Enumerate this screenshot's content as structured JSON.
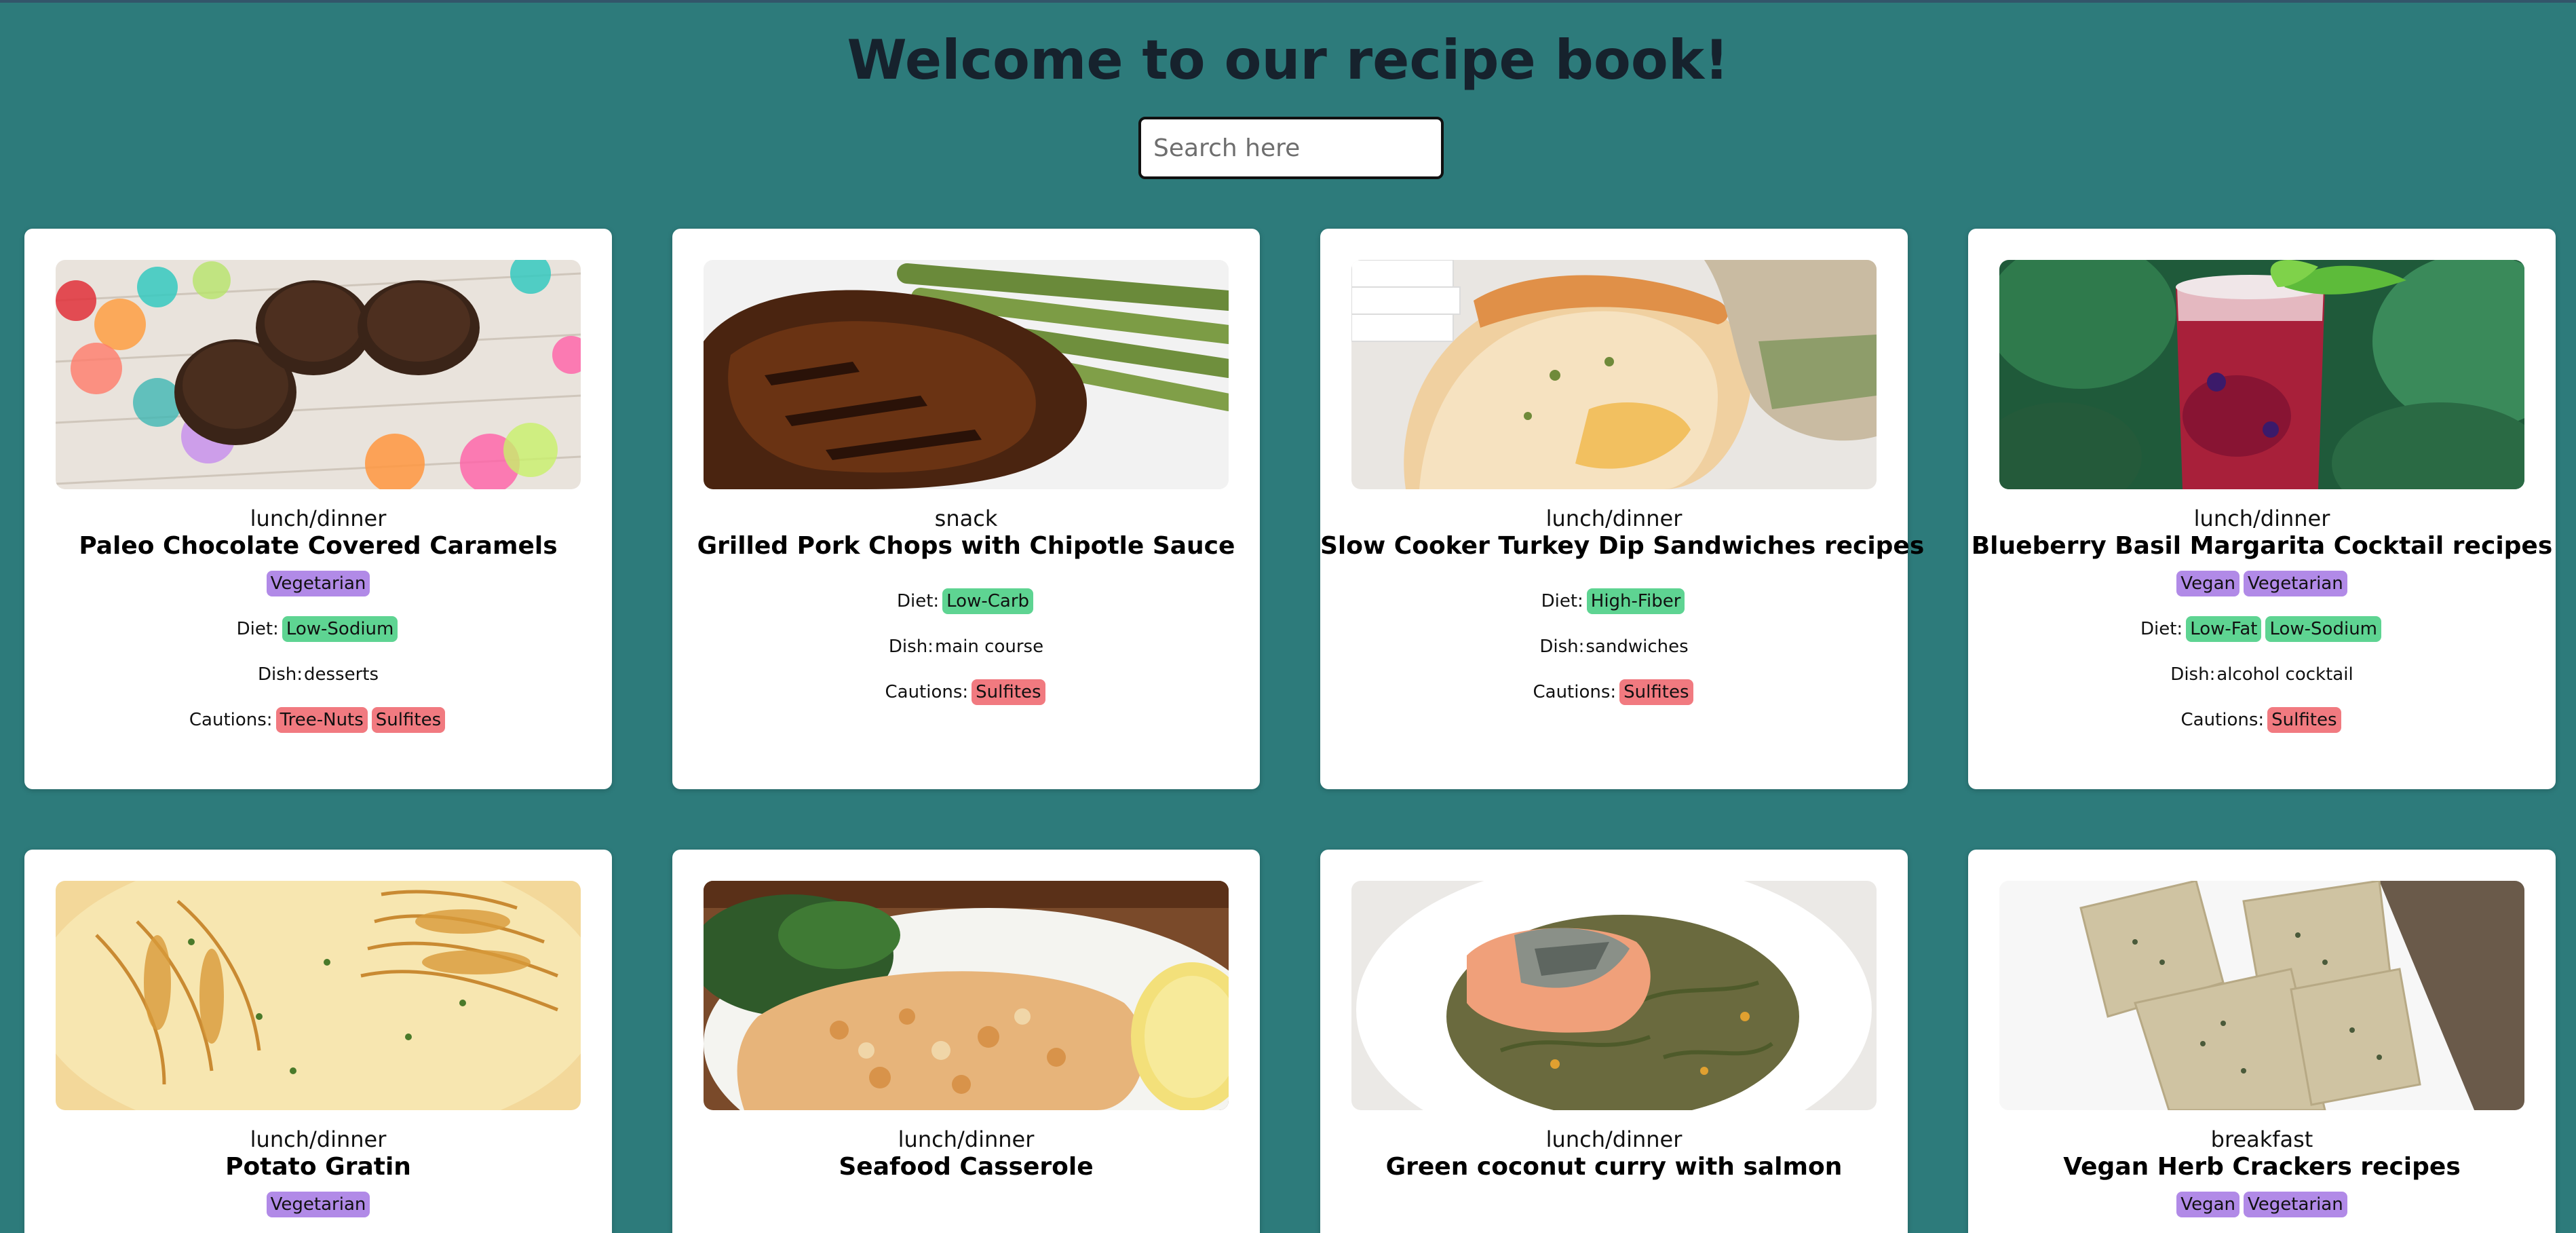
{
  "header": {
    "title": "Welcome to our recipe book!"
  },
  "search": {
    "placeholder": "Search here",
    "value": ""
  },
  "labels": {
    "diet": "Diet:",
    "dish": "Dish:",
    "cautions": "Cautions:"
  },
  "colors": {
    "background": "#2d7b7b",
    "health_tag": "#b18ae7",
    "diet_tag": "#5ed492",
    "caution_tag": "#f17a80"
  },
  "recipes": [
    {
      "meal": "lunch/dinner",
      "title": "Paleo Chocolate Covered Caramels",
      "health": [
        "Vegetarian"
      ],
      "diet": [
        "Low-Sodium"
      ],
      "dish": "desserts",
      "cautions": [
        "Tree-Nuts",
        "Sulfites"
      ]
    },
    {
      "meal": "snack",
      "title": "Grilled Pork Chops with Chipotle Sauce",
      "health": [],
      "diet": [
        "Low-Carb"
      ],
      "dish": "main course",
      "cautions": [
        "Sulfites"
      ]
    },
    {
      "meal": "lunch/dinner",
      "title": "Slow Cooker Turkey Dip Sandwiches recipes",
      "health": [],
      "diet": [
        "High-Fiber"
      ],
      "dish": "sandwiches",
      "cautions": [
        "Sulfites"
      ]
    },
    {
      "meal": "lunch/dinner",
      "title": "Blueberry Basil Margarita Cocktail recipes",
      "health": [
        "Vegan",
        "Vegetarian"
      ],
      "diet": [
        "Low-Fat",
        "Low-Sodium"
      ],
      "dish": "alcohol cocktail",
      "cautions": [
        "Sulfites"
      ]
    },
    {
      "meal": "lunch/dinner",
      "title": "Potato Gratin",
      "health": [
        "Vegetarian"
      ],
      "diet": [],
      "dish": "",
      "cautions": []
    },
    {
      "meal": "lunch/dinner",
      "title": "Seafood Casserole",
      "health": [],
      "diet": [],
      "dish": "",
      "cautions": []
    },
    {
      "meal": "lunch/dinner",
      "title": "Green coconut curry with salmon",
      "health": [],
      "diet": [],
      "dish": "",
      "cautions": []
    },
    {
      "meal": "breakfast",
      "title": "Vegan Herb Crackers recipes",
      "health": [
        "Vegan",
        "Vegetarian"
      ],
      "diet": [],
      "dish": "",
      "cautions": []
    }
  ]
}
